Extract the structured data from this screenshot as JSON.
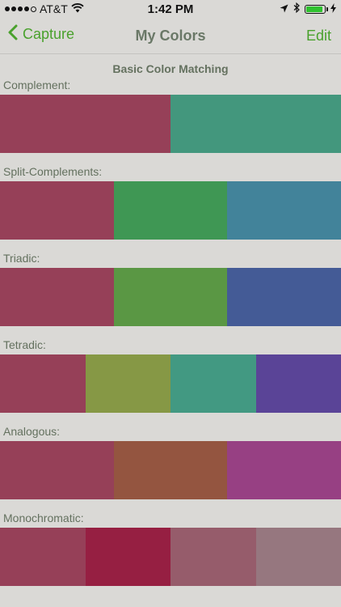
{
  "status_bar": {
    "carrier": "AT&T",
    "time": "1:42 PM",
    "battery_level": 0.9,
    "battery_color": "#2fc12f"
  },
  "nav": {
    "back_label": "Capture",
    "title": "My Colors",
    "edit_label": "Edit",
    "accent_color": "#49a12c"
  },
  "section_heading": "Basic Color Matching",
  "schemes": [
    {
      "label": "Complement:",
      "colors": [
        "#964058",
        "#43977d"
      ]
    },
    {
      "label": "Split-Complements:",
      "colors": [
        "#964058",
        "#3f9754",
        "#42839a"
      ]
    },
    {
      "label": "Triadic:",
      "colors": [
        "#964058",
        "#5a9744",
        "#445b96"
      ]
    },
    {
      "label": "Tetradic:",
      "colors": [
        "#964058",
        "#869845",
        "#429982",
        "#5a4497"
      ]
    },
    {
      "label": "Analogous:",
      "colors": [
        "#964058",
        "#945540",
        "#974083"
      ]
    },
    {
      "label": "Monochromatic:",
      "colors": [
        "#964058",
        "#961f42",
        "#965c6b",
        "#96777f"
      ]
    }
  ]
}
